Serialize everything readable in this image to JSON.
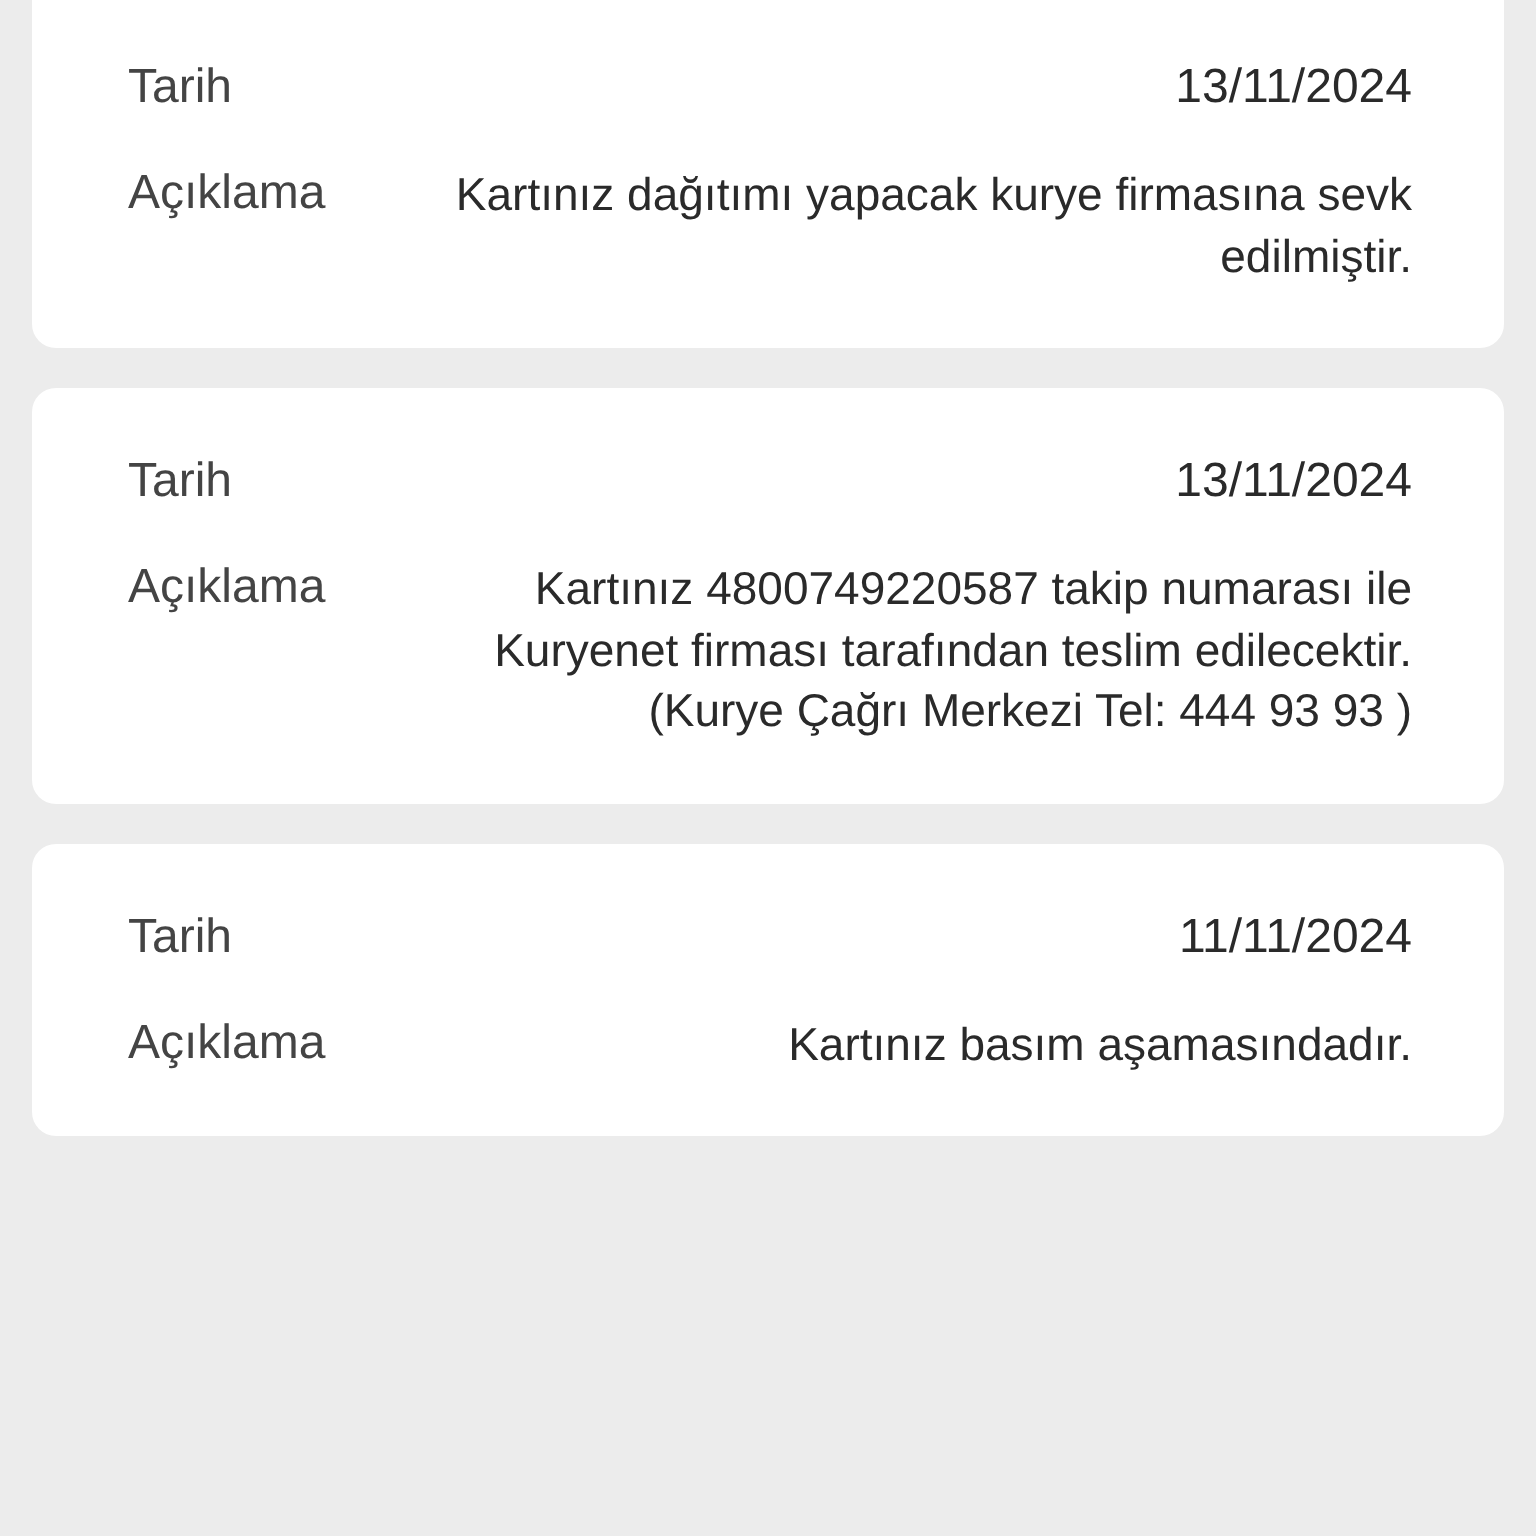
{
  "entries": [
    {
      "date_label": "Tarih",
      "date": "13/11/2024",
      "description_label": "Açıklama",
      "description": "Kartınız dağıtımı yapacak kurye firmasına sevk edilmiştir."
    },
    {
      "date_label": "Tarih",
      "date": "13/11/2024",
      "description_label": "Açıklama",
      "description": "Kartınız 4800749220587 takip numarası ile Kuryenet firması tarafından teslim edilecektir.(Kurye Çağrı Merkezi Tel: 444 93 93 )"
    },
    {
      "date_label": "Tarih",
      "date": "11/11/2024",
      "description_label": "Açıklama",
      "description": "Kartınız basım aşamasındadır."
    }
  ]
}
